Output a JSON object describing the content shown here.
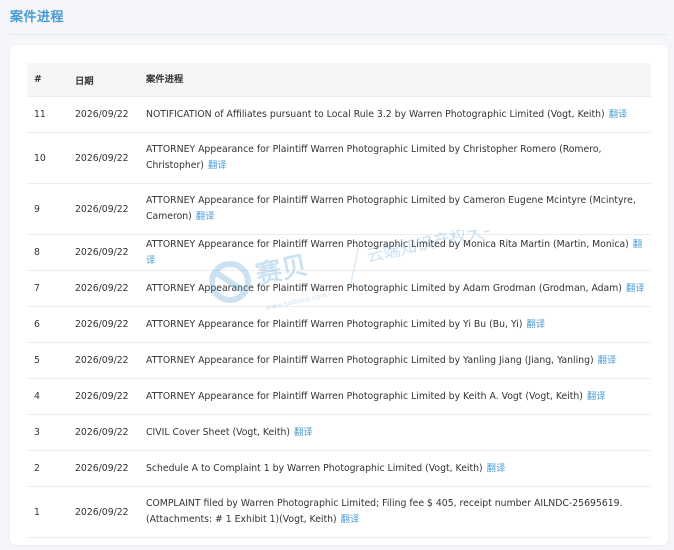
{
  "section_title": "案件进程",
  "columns": {
    "num": "#",
    "date": "日期",
    "desc": "案件进程"
  },
  "translate_label": "翻译",
  "rows": [
    {
      "num": "11",
      "date": "2026/09/22",
      "desc": "NOTIFICATION of Affiliates pursuant to Local Rule 3.2 by Warren Photographic Limited (Vogt, Keith)"
    },
    {
      "num": "10",
      "date": "2026/09/22",
      "desc": "ATTORNEY Appearance for Plaintiff Warren Photographic Limited by Christopher Romero (Romero, Christopher)"
    },
    {
      "num": "9",
      "date": "2026/09/22",
      "desc": "ATTORNEY Appearance for Plaintiff Warren Photographic Limited by Cameron Eugene Mcintyre (Mcintyre, Cameron)"
    },
    {
      "num": "8",
      "date": "2026/09/22",
      "desc": "ATTORNEY Appearance for Plaintiff Warren Photographic Limited by Monica Rita Martin (Martin, Monica)"
    },
    {
      "num": "7",
      "date": "2026/09/22",
      "desc": "ATTORNEY Appearance for Plaintiff Warren Photographic Limited by Adam Grodman (Grodman, Adam)"
    },
    {
      "num": "6",
      "date": "2026/09/22",
      "desc": "ATTORNEY Appearance for Plaintiff Warren Photographic Limited by Yi Bu (Bu, Yi)"
    },
    {
      "num": "5",
      "date": "2026/09/22",
      "desc": "ATTORNEY Appearance for Plaintiff Warren Photographic Limited by Yanling Jiang (Jiang, Yanling)"
    },
    {
      "num": "4",
      "date": "2026/09/22",
      "desc": "ATTORNEY Appearance for Plaintiff Warren Photographic Limited by Keith A. Vogt (Vogt, Keith)"
    },
    {
      "num": "3",
      "date": "2026/09/22",
      "desc": "CIVIL Cover Sheet (Vogt, Keith)"
    },
    {
      "num": "2",
      "date": "2026/09/22",
      "desc": "Schedule A to Complaint 1 by Warren Photographic Limited (Vogt, Keith)"
    },
    {
      "num": "1",
      "date": "2026/09/22",
      "desc": "COMPLAINT filed by Warren Photographic Limited; Filing fee $ 405, receipt number AILNDC-25695619. (Attachments: # 1 Exhibit 1)(Vogt, Keith)"
    }
  ],
  "watermark": {
    "brand": "赛贝",
    "slogan": "云端知识产权大平台",
    "url": "www.saibeiip.com",
    "color": "#4a9bd1"
  }
}
